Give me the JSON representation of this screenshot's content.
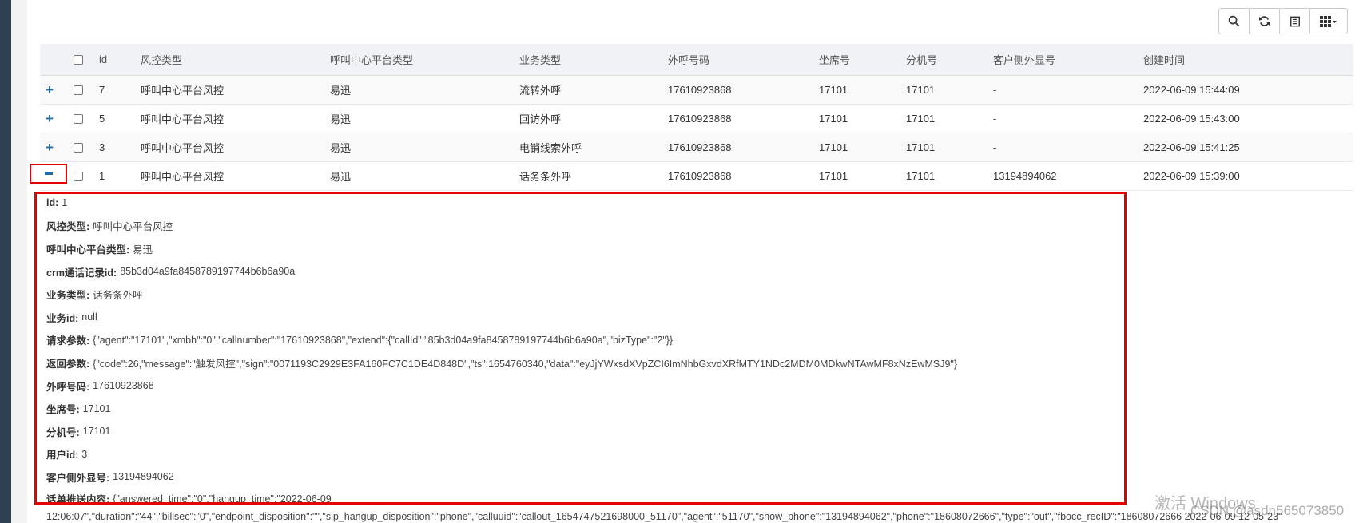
{
  "toolbar": {
    "icons": [
      "search-icon",
      "refresh-icon",
      "list-icon",
      "columns-icon"
    ]
  },
  "table": {
    "headers": [
      "id",
      "风控类型",
      "呼叫中心平台类型",
      "业务类型",
      "外呼号码",
      "坐席号",
      "分机号",
      "客户侧外显号",
      "创建时间"
    ],
    "rows": [
      [
        "7",
        "呼叫中心平台风控",
        "易迅",
        "流转外呼",
        "17610923868",
        "17101",
        "17101",
        "-",
        "2022-06-09 15:44:09"
      ],
      [
        "5",
        "呼叫中心平台风控",
        "易迅",
        "回访外呼",
        "17610923868",
        "17101",
        "17101",
        "-",
        "2022-06-09 15:43:00"
      ],
      [
        "3",
        "呼叫中心平台风控",
        "易迅",
        "电销线索外呼",
        "17610923868",
        "17101",
        "17101",
        "-",
        "2022-06-09 15:41:25"
      ],
      [
        "1",
        "呼叫中心平台风控",
        "易迅",
        "话务条外呼",
        "17610923868",
        "17101",
        "17101",
        "13194894062",
        "2022-06-09 15:39:00"
      ]
    ]
  },
  "detail": [
    {
      "label": "id:",
      "value": "1"
    },
    {
      "label": "风控类型:",
      "value": "呼叫中心平台风控"
    },
    {
      "label": "呼叫中心平台类型:",
      "value": "易迅"
    },
    {
      "label": "crm通话记录id:",
      "value": "85b3d04a9fa8458789197744b6b6a90a"
    },
    {
      "label": "业务类型:",
      "value": "话务条外呼"
    },
    {
      "label": "业务id:",
      "value": "null"
    },
    {
      "label": "请求参数:",
      "value": "{\"agent\":\"17101\",\"xmbh\":\"0\",\"callnumber\":\"17610923868\",\"extend\":{\"callId\":\"85b3d04a9fa8458789197744b6b6a90a\",\"bizType\":\"2\"}}"
    },
    {
      "label": "返回参数:",
      "value": "{\"code\":26,\"message\":\"触发风控\",\"sign\":\"0071193C2929E3FA160FC7C1DE4D848D\",\"ts\":1654760340,\"data\":\"eyJjYWxsdXVpZCI6ImNhbGxvdXRfMTY1NDc2MDM0MDkwNTAwMF8xNzEwMSJ9\"}"
    },
    {
      "label": "外呼号码:",
      "value": "17610923868"
    },
    {
      "label": "坐席号:",
      "value": "17101"
    },
    {
      "label": "分机号:",
      "value": "17101"
    },
    {
      "label": "用户id:",
      "value": "3"
    },
    {
      "label": "客户侧外显号:",
      "value": "13194894062"
    },
    {
      "label": "话单推送内容:",
      "value": "{\"answered_time\":\"0\",\"hangup_time\":\"2022-06-09"
    }
  ],
  "detail_overflow": "12:06:07\",\"duration\":\"44\",\"billsec\":\"0\",\"endpoint_disposition\":\"\",\"sip_hangup_disposition\":\"phone\",\"calluuid\":\"callout_1654747521698000_51170\",\"agent\":\"51170\",\"show_phone\":\"13194894062\",\"phone\":\"18608072666\",\"type\":\"out\",\"fbocc_recID\":\"18608072666 2022-06-09 12-05-23\"",
  "watermark": {
    "line1": "激活 Windows",
    "line2": "CSDN @asdn565073850"
  }
}
